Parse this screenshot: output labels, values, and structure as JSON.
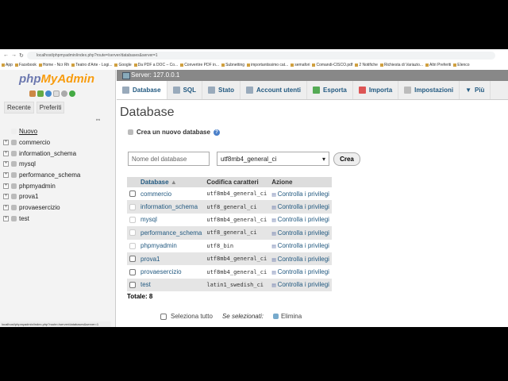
{
  "browser": {
    "url": "localhost/phpmyadmin/index.php?route=/server/databases&server=1",
    "bookmarks": [
      "App",
      "Facebook",
      "Home - Ncr Rh",
      "Teatro d'Arte - Logi...",
      "Google",
      "Da PDF a DOC – Co...",
      "Convertire PDF in...",
      "Subnetting",
      "importantissimo cat...",
      "semafori",
      "Comandi-CISCO.pdf",
      "2 Notifiche",
      "Richiesta di Variazio...",
      "Altri Preferiti",
      "Elenco"
    ]
  },
  "sidebar": {
    "logo_a": "php",
    "logo_b": "MyAdmin",
    "tabs": [
      "Recente",
      "Preferiti"
    ],
    "new": "Nuovo",
    "databases": [
      "commercio",
      "information_schema",
      "mysql",
      "performance_schema",
      "phpmyadmin",
      "prova1",
      "provaesercizio",
      "test"
    ]
  },
  "server": "Server: 127.0.0.1",
  "menu": [
    "Database",
    "SQL",
    "Stato",
    "Account utenti",
    "Esporta",
    "Importa",
    "Impostazioni",
    "Più"
  ],
  "title": "Database",
  "create": {
    "label": "Crea un nuovo database",
    "placeholder": "Nome del database",
    "collation": "utf8mb4_general_ci",
    "button": "Crea"
  },
  "table": {
    "headers": [
      "Database",
      "Codifica caratteri",
      "Azione"
    ],
    "rows": [
      {
        "name": "commercio",
        "collation": "utf8mb4_general_ci",
        "action": "Controlla i privilegi"
      },
      {
        "name": "information_schema",
        "collation": "utf8_general_ci",
        "action": "Controlla i privilegi"
      },
      {
        "name": "mysql",
        "collation": "utf8mb4_general_ci",
        "action": "Controlla i privilegi"
      },
      {
        "name": "performance_schema",
        "collation": "utf8_general_ci",
        "action": "Controlla i privilegi"
      },
      {
        "name": "phpmyadmin",
        "collation": "utf8_bin",
        "action": "Controlla i privilegi"
      },
      {
        "name": "prova1",
        "collation": "utf8mb4_general_ci",
        "action": "Controlla i privilegi"
      },
      {
        "name": "provaesercizio",
        "collation": "utf8mb4_general_ci",
        "action": "Controlla i privilegi"
      },
      {
        "name": "test",
        "collation": "latin1_swedish_ci",
        "action": "Controlla i privilegi"
      }
    ]
  },
  "total": "Totale: 8",
  "footer": {
    "select_all": "Seleziona tutto",
    "with_selected": "Se selezionati:",
    "delete": "Elimina"
  },
  "status_url": "localhost/phpmyadmin/index.php?route=/server/databases&server=1"
}
